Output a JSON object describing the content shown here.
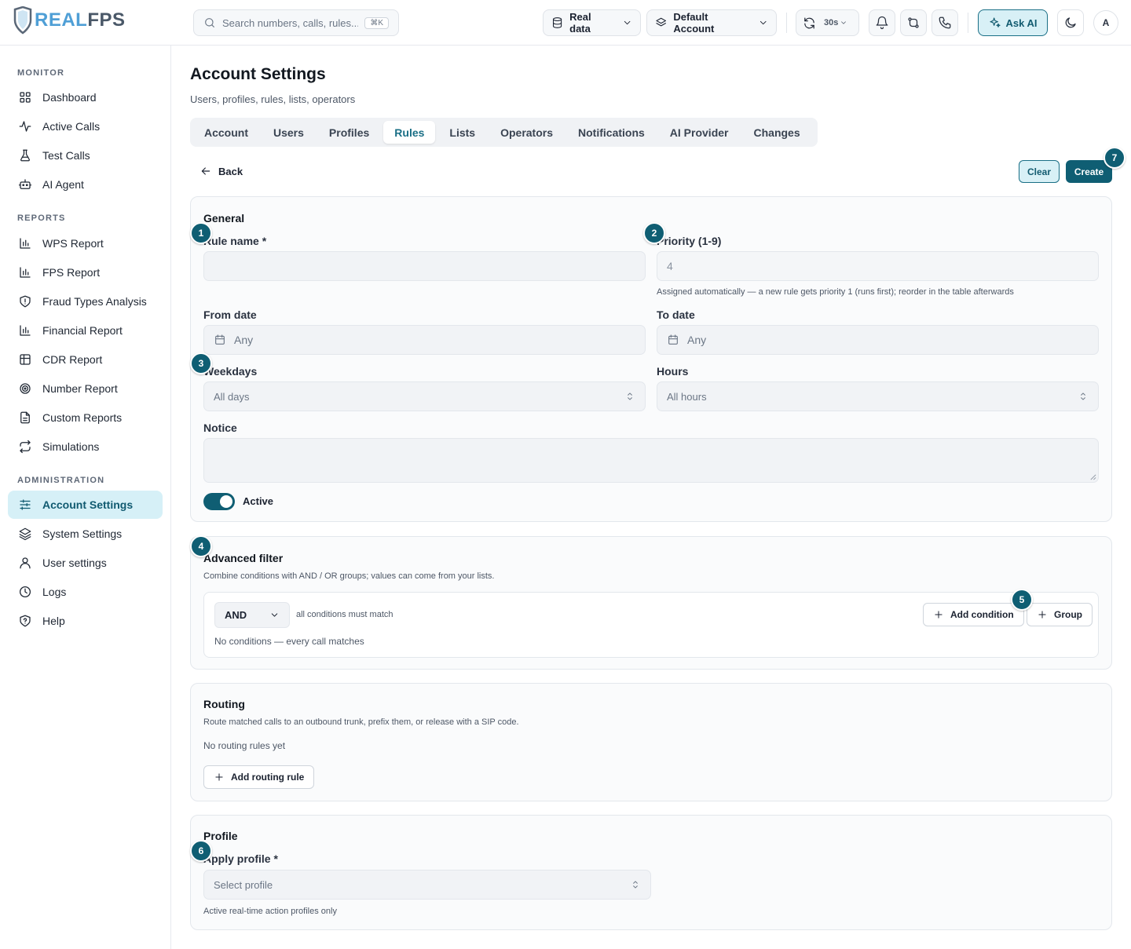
{
  "app": {
    "logo_text_a": "REAL",
    "logo_text_b": "FPS"
  },
  "topbar": {
    "search_placeholder": "Search numbers, calls, rules...",
    "search_shortcut": "⌘K",
    "data_source": "Real data",
    "account": "Default Account",
    "refresh_interval": "30s",
    "ask_ai": "Ask AI",
    "avatar_initial": "A"
  },
  "sidebar": {
    "sections": [
      {
        "title": "MONITOR",
        "items": [
          {
            "label": "Dashboard",
            "icon": "grid-icon"
          },
          {
            "label": "Active Calls",
            "icon": "activity-icon"
          },
          {
            "label": "Test Calls",
            "icon": "flask-icon"
          },
          {
            "label": "AI Agent",
            "icon": "bot-icon"
          }
        ]
      },
      {
        "title": "REPORTS",
        "items": [
          {
            "label": "WPS Report",
            "icon": "bar-chart-icon"
          },
          {
            "label": "FPS Report",
            "icon": "bar-chart-icon"
          },
          {
            "label": "Fraud Types Analysis",
            "icon": "shield-icon"
          },
          {
            "label": "Financial Report",
            "icon": "bar-chart-icon"
          },
          {
            "label": "CDR Report",
            "icon": "table-icon"
          },
          {
            "label": "Number Report",
            "icon": "target-icon"
          },
          {
            "label": "Custom Reports",
            "icon": "file-icon"
          },
          {
            "label": "Simulations",
            "icon": "repeat-icon"
          }
        ]
      },
      {
        "title": "ADMINISTRATION",
        "items": [
          {
            "label": "Account Settings",
            "icon": "sliders-icon",
            "active": true
          },
          {
            "label": "System Settings",
            "icon": "layers-icon"
          },
          {
            "label": "User settings",
            "icon": "user-icon"
          },
          {
            "label": "Logs",
            "icon": "clock-icon"
          },
          {
            "label": "Help",
            "icon": "help-shield-icon"
          }
        ]
      }
    ]
  },
  "page": {
    "title": "Account Settings",
    "subtitle": "Users, profiles, rules, lists, operators",
    "tabs": [
      "Account",
      "Users",
      "Profiles",
      "Rules",
      "Lists",
      "Operators",
      "Notifications",
      "AI Provider",
      "Changes"
    ],
    "active_tab": "Rules",
    "back_label": "Back",
    "clear_label": "Clear",
    "create_label": "Create"
  },
  "general": {
    "heading": "General",
    "rule_name_label": "Rule name *",
    "rule_name_value": "",
    "priority_label": "Priority (1-9)",
    "priority_value": "4",
    "priority_hint": "Assigned automatically — a new rule gets priority 1 (runs first); reorder in the table afterwards",
    "from_date_label": "From date",
    "from_date_value": "Any",
    "to_date_label": "To date",
    "to_date_value": "Any",
    "weekdays_label": "Weekdays",
    "weekdays_value": "All days",
    "hours_label": "Hours",
    "hours_value": "All hours",
    "notice_label": "Notice",
    "notice_value": "",
    "active_label": "Active",
    "active": true
  },
  "advanced_filter": {
    "heading": "Advanced filter",
    "description": "Combine conditions with AND / OR groups; values can come from your lists.",
    "operator": "AND",
    "operator_hint": "all conditions must match",
    "empty_text": "No conditions — every call matches",
    "add_condition_label": "Add condition",
    "group_label": "Group"
  },
  "routing": {
    "heading": "Routing",
    "description": "Route matched calls to an outbound trunk, prefix them, or release with a SIP code.",
    "empty_text": "No routing rules yet",
    "add_label": "Add routing rule"
  },
  "profile": {
    "heading": "Profile",
    "apply_label": "Apply profile *",
    "placeholder": "Select profile",
    "hint": "Active real-time action profiles only"
  },
  "badges": [
    "1",
    "2",
    "3",
    "4",
    "5",
    "6",
    "7"
  ],
  "colors": {
    "accent": "#0f5e73",
    "accent_light": "#d8f0f6",
    "logo_blue": "#4f9fd6"
  }
}
